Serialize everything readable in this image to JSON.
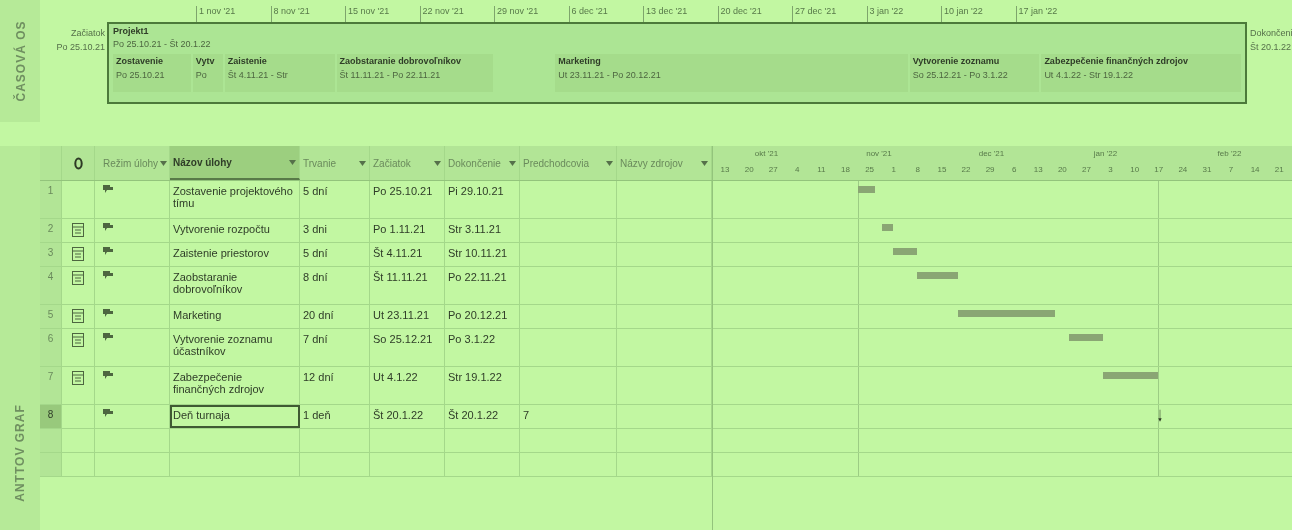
{
  "side_labels": {
    "timeline": "ČASOVÁ OS",
    "gantt": "ANTTOV GRAF"
  },
  "timeline": {
    "ticks": [
      "1 nov '21",
      "8 nov '21",
      "15 nov '21",
      "22 nov '21",
      "29 nov '21",
      "6 dec '21",
      "13 dec '21",
      "20 dec '21",
      "27 dec '21",
      "3 jan '22",
      "10 jan '22",
      "17 jan '22"
    ],
    "start_label": "Začiatok",
    "start_date": "Po 25.10.21",
    "finish_label": "Dokončeni",
    "finish_date": "Št 20.1.22",
    "project": {
      "name": "Projekt1",
      "dates": "Po 25.10.21 - Št 20.1.22"
    },
    "tasks": [
      {
        "name": "Zostavenie",
        "dates": "Po 25.10.21"
      },
      {
        "name": "Vytv",
        "dates": "Po"
      },
      {
        "name": "Zaistenie",
        "dates": "Št 4.11.21 - Str"
      },
      {
        "name": "Zaobstaranie dobrovoľníkov",
        "dates": "Št 11.11.21 - Po 22.11.21"
      },
      {
        "name": "Marketing",
        "dates": "Ut 23.11.21 - Po 20.12.21"
      },
      {
        "name": "Vytvorenie zoznamu",
        "dates": "So 25.12.21 - Po 3.1.22"
      },
      {
        "name": "Zabezpečenie finančných zdrojov",
        "dates": "Ut 4.1.22 - Str 19.1.22"
      }
    ]
  },
  "table": {
    "columns": [
      {
        "label": "Režim úlohy",
        "selected": false
      },
      {
        "label": "Názov úlohy",
        "selected": true
      },
      {
        "label": "Trvanie",
        "selected": false
      },
      {
        "label": "Začiatok",
        "selected": false
      },
      {
        "label": "Dokončenie",
        "selected": false
      },
      {
        "label": "Predchodcovia",
        "selected": false
      },
      {
        "label": "Názvy zdrojov",
        "selected": false
      }
    ],
    "rows": [
      {
        "id": "1",
        "calendar": false,
        "name": "Zostavenie projektového tímu",
        "duration": "5 dní",
        "start": "Po 25.10.21",
        "finish": "Pi 29.10.21",
        "predecessors": "",
        "selected": false
      },
      {
        "id": "2",
        "calendar": true,
        "name": "Vytvorenie rozpočtu",
        "duration": "3 dni",
        "start": "Po 1.11.21",
        "finish": "Str 3.11.21",
        "predecessors": "",
        "selected": false
      },
      {
        "id": "3",
        "calendar": true,
        "name": "Zaistenie priestorov",
        "duration": "5 dní",
        "start": "Št 4.11.21",
        "finish": "Str 10.11.21",
        "predecessors": "",
        "selected": false
      },
      {
        "id": "4",
        "calendar": true,
        "name": "Zaobstaranie dobrovoľníkov",
        "duration": "8 dní",
        "start": "Št 11.11.21",
        "finish": "Po 22.11.21",
        "predecessors": "",
        "selected": false
      },
      {
        "id": "5",
        "calendar": true,
        "name": "Marketing",
        "duration": "20 dní",
        "start": "Ut 23.11.21",
        "finish": "Po 20.12.21",
        "predecessors": "",
        "selected": false
      },
      {
        "id": "6",
        "calendar": true,
        "name": "Vytvorenie zoznamu účastníkov",
        "duration": "7 dní",
        "start": "So 25.12.21",
        "finish": "Po 3.1.22",
        "predecessors": "",
        "selected": false
      },
      {
        "id": "7",
        "calendar": true,
        "name": "Zabezpečenie finančných zdrojov",
        "duration": "12 dní",
        "start": "Ut 4.1.22",
        "finish": "Str 19.1.22",
        "predecessors": "",
        "selected": false
      },
      {
        "id": "8",
        "calendar": false,
        "name": "Deň turnaja",
        "duration": "1 deň",
        "start": "Št 20.1.22",
        "finish": "Št 20.1.22",
        "predecessors": "7",
        "selected": true
      }
    ]
  },
  "gantt": {
    "months": [
      "okt '21",
      "nov '21",
      "dec '21",
      "jan '22",
      "feb '22"
    ],
    "weeks": [
      "13",
      "20",
      "27",
      "4",
      "11",
      "18",
      "25",
      "1",
      "8",
      "15",
      "22",
      "29",
      "6",
      "13",
      "20",
      "27",
      "3",
      "10",
      "17",
      "24",
      "31",
      "7",
      "14",
      "21"
    ]
  }
}
